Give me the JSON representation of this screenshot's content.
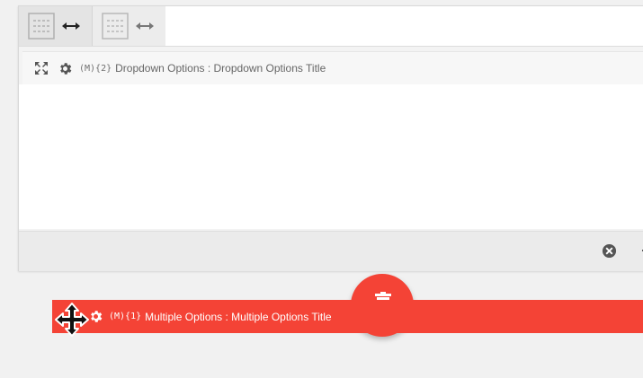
{
  "toolbar": {
    "layout_buttons": [
      {
        "icon": "layout-grid-icon",
        "arrow": "resize-horizontal-arrows-icon"
      },
      {
        "icon": "layout-grid-icon",
        "arrow": "resize-horizontal-arrows-icon"
      }
    ]
  },
  "field_row": {
    "code": "(M){2}",
    "label": "Dropdown Options : Dropdown Options Title"
  },
  "footer": {
    "close_icon": "close-circle-icon"
  },
  "dragged_row": {
    "code": "(M){1}",
    "label": "Multiple Options : Multiple Options Title"
  },
  "colors": {
    "accent": "#f44336",
    "panel_bg": "#f3f3f3",
    "text_muted": "#666666"
  }
}
